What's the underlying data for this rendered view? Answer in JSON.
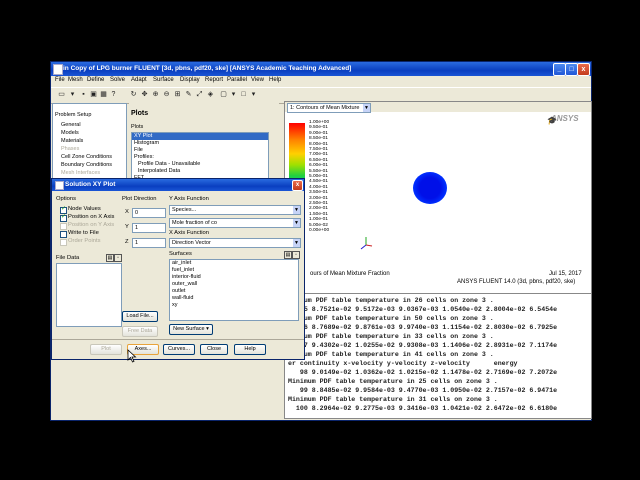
{
  "window": {
    "title": "in Copy of LPG burner FLUENT  [3d, pbns, pdf20, ske] [ANSYS Academic Teaching Advanced]",
    "controls": {
      "minimize": "_",
      "maximize": "□",
      "close": "x"
    }
  },
  "menu": [
    "File",
    "Mesh",
    "Define",
    "Solve",
    "Adapt",
    "Surface",
    "Display",
    "Report",
    "Parallel",
    "View",
    "Help"
  ],
  "tree": {
    "header": "Problem Setup",
    "items": [
      "General",
      "Models",
      "Materials",
      "Phases",
      "Cell Zone Conditions",
      "Boundary Conditions",
      "Mesh Interfaces"
    ]
  },
  "plots": {
    "title": "Plots",
    "list_label": "Plots",
    "items": [
      "XY Plot",
      "Histogram",
      "File",
      "Profiles:",
      "Profile Data - Unavailable",
      "Interpolated Data",
      "FFT"
    ]
  },
  "graphics": {
    "selector": "1: Contours of Mean Mixture",
    "logo": "ANSYS",
    "colorbar_labels": [
      "1.00e+00",
      "9.50e-01",
      "9.00e-01",
      "8.50e-01",
      "8.00e-01",
      "7.50e-01",
      "7.00e-01",
      "6.50e-01",
      "6.00e-01",
      "5.50e-01",
      "5.00e-01",
      "4.50e-01",
      "4.00e-01",
      "3.50e-01",
      "3.00e-01",
      "2.50e-01",
      "2.00e-01",
      "1.50e-01",
      "1.00e-01",
      "5.00e-02",
      "0.00e+00"
    ],
    "caption": "ours of Mean Mixture Fraction",
    "date": "Jul 15, 2017",
    "version": "ANSYS FLUENT 14.0 (3d, pbns, pdf20, ske)"
  },
  "console_lines": [
    "inimum PDF table temperature in 26 cells on zone 3 .",
    "   95 8.7521e-02 9.5172e-03 9.0367e-03 1.0540e-02 2.8004e-02 6.5454e",
    "inimum PDF table temperature in 50 cells on zone 3 .",
    "   96 8.7689e-02 9.8761e-03 9.9740e-03 1.1154e-02 2.8030e-02 6.7925e",
    "inimum PDF table temperature in 33 cells on zone 3 .",
    "   97 9.4302e-02 1.0255e-02 9.9308e-03 1.1406e-02 2.8931e-02 7.1174e",
    "inimum PDF table temperature in 41 cells on zone 3 .",
    "er continuity x-velocity y-velocity z-velocity      energy",
    "   98 9.0149e-02 1.0362e-02 1.0215e-02 1.1478e-02 2.7169e-02 7.2072e",
    "Minimum PDF table temperature in 25 cells on zone 3 .",
    "   99 8.8485e-02 9.9584e-03 9.4770e-03 1.0950e-02 2.7157e-02 6.9471e",
    "Minimum PDF table temperature in 31 cells on zone 3 .",
    "  100 8.2964e-02 9.2775e-03 9.3416e-03 1.0421e-02 2.6472e-02 6.6180e"
  ],
  "dialog": {
    "title": "Solution XY Plot",
    "options_label": "Options",
    "options": [
      {
        "label": "Node Values",
        "checked": true,
        "enabled": true
      },
      {
        "label": "Position on X Axis",
        "checked": true,
        "enabled": true
      },
      {
        "label": "Position on Y Axis",
        "checked": false,
        "enabled": false
      },
      {
        "label": "Write to File",
        "checked": false,
        "enabled": true
      },
      {
        "label": "Order Points",
        "checked": false,
        "enabled": false
      }
    ],
    "plot_direction_label": "Plot Direction",
    "x_label": "X",
    "x_value": "0",
    "y_label": "Y",
    "y_value": "1",
    "z_label": "Z",
    "z_value": "1",
    "y_axis_function_label": "Y Axis Function",
    "y_axis_category": "Species...",
    "y_axis_quantity": "Mole fraction of co",
    "x_axis_function_label": "X Axis Function",
    "x_axis_value": "Direction Vector",
    "file_data_label": "File Data",
    "surfaces_label": "Surfaces",
    "surfaces": [
      "air_inlet",
      "fuel_inlet",
      "interior-fluid",
      "outer_wall",
      "outlet",
      "wall-fluid",
      "xy"
    ],
    "new_surface": "New Surface",
    "load_file": "Load File...",
    "free_data": "Free Data",
    "buttons": {
      "plot": "Plot",
      "axes": "Axes...",
      "curves": "Curves...",
      "close": "Close",
      "help": "Help"
    }
  }
}
